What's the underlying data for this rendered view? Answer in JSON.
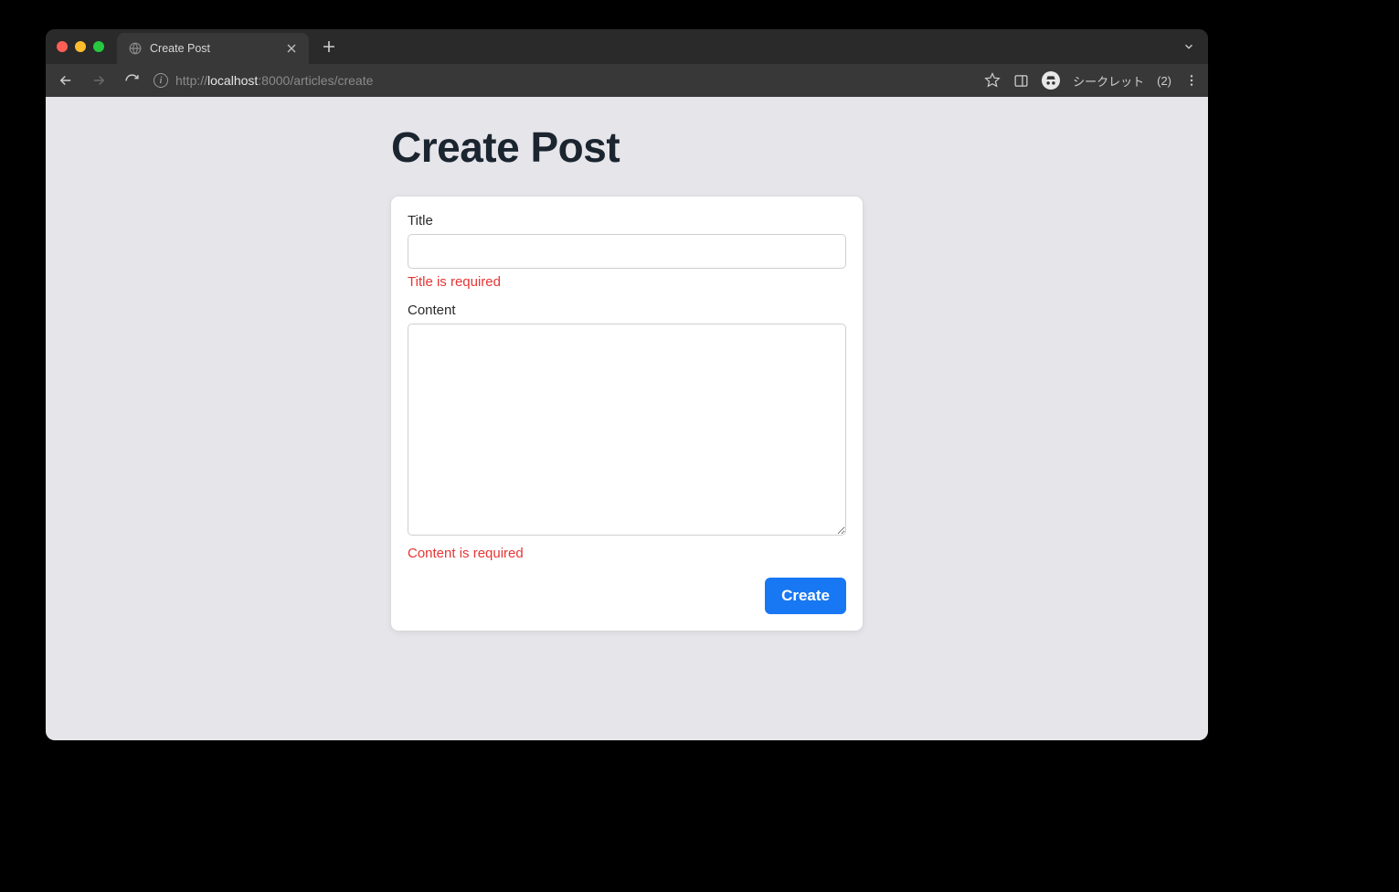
{
  "browser": {
    "tab_title": "Create Post",
    "url": {
      "protocol": "http://",
      "host": "localhost",
      "port": ":8000",
      "path": "/articles/create"
    },
    "incognito_label": "シークレット",
    "incognito_count": "(2)"
  },
  "page": {
    "heading": "Create Post",
    "form": {
      "title": {
        "label": "Title",
        "value": "",
        "error": "Title is required"
      },
      "content": {
        "label": "Content",
        "value": "",
        "error": "Content is required"
      },
      "submit_label": "Create"
    }
  }
}
